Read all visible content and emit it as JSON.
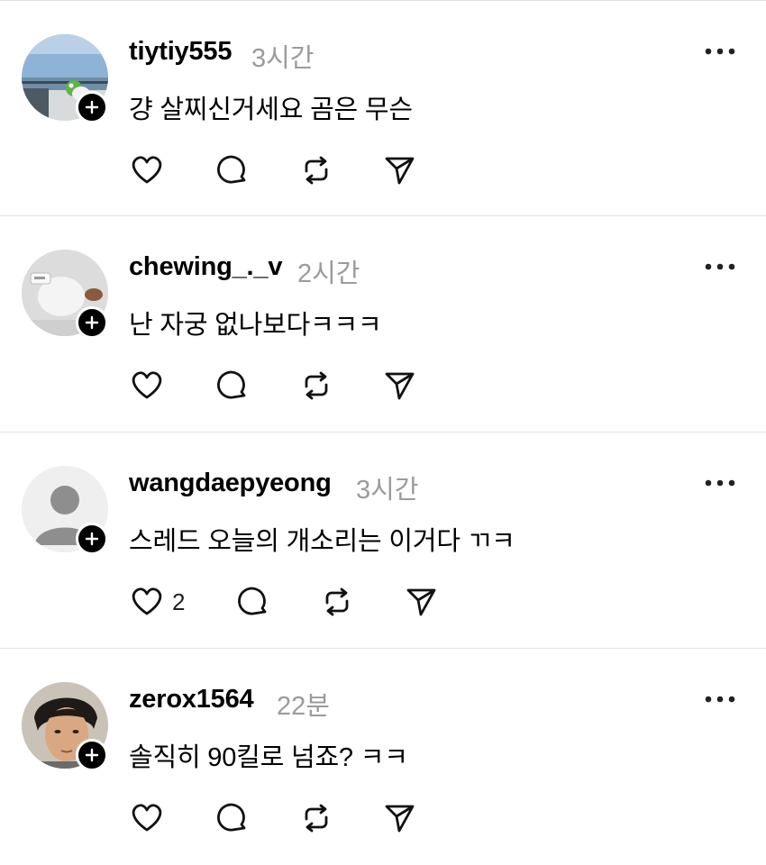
{
  "posts": [
    {
      "username": "tiytiy555",
      "time": "3시간",
      "text": "걍 살찌신거세요 곰은 무슨",
      "likes": ""
    },
    {
      "username": "chewing_._v",
      "time": "2시간",
      "text": "난 자궁 없나보다ㅋㅋㅋ",
      "likes": ""
    },
    {
      "username": "wangdaepyeong",
      "time": "3시간",
      "text": "스레드 오늘의 개소리는 이거다 ㄲㅋ",
      "likes": "2"
    },
    {
      "username": "zerox1564",
      "time": "22분",
      "text": "솔직히 90킬로 넘죠? ㅋㅋ",
      "likes": ""
    }
  ],
  "icons": {
    "follow": "plus-icon",
    "more": "more-horizontal-icon",
    "like": "heart-icon",
    "reply": "comment-icon",
    "repost": "repost-icon",
    "share": "send-icon"
  },
  "colors": {
    "text": "#000000",
    "muted": "#9b9b9b",
    "divider": "#e3e3e3"
  }
}
